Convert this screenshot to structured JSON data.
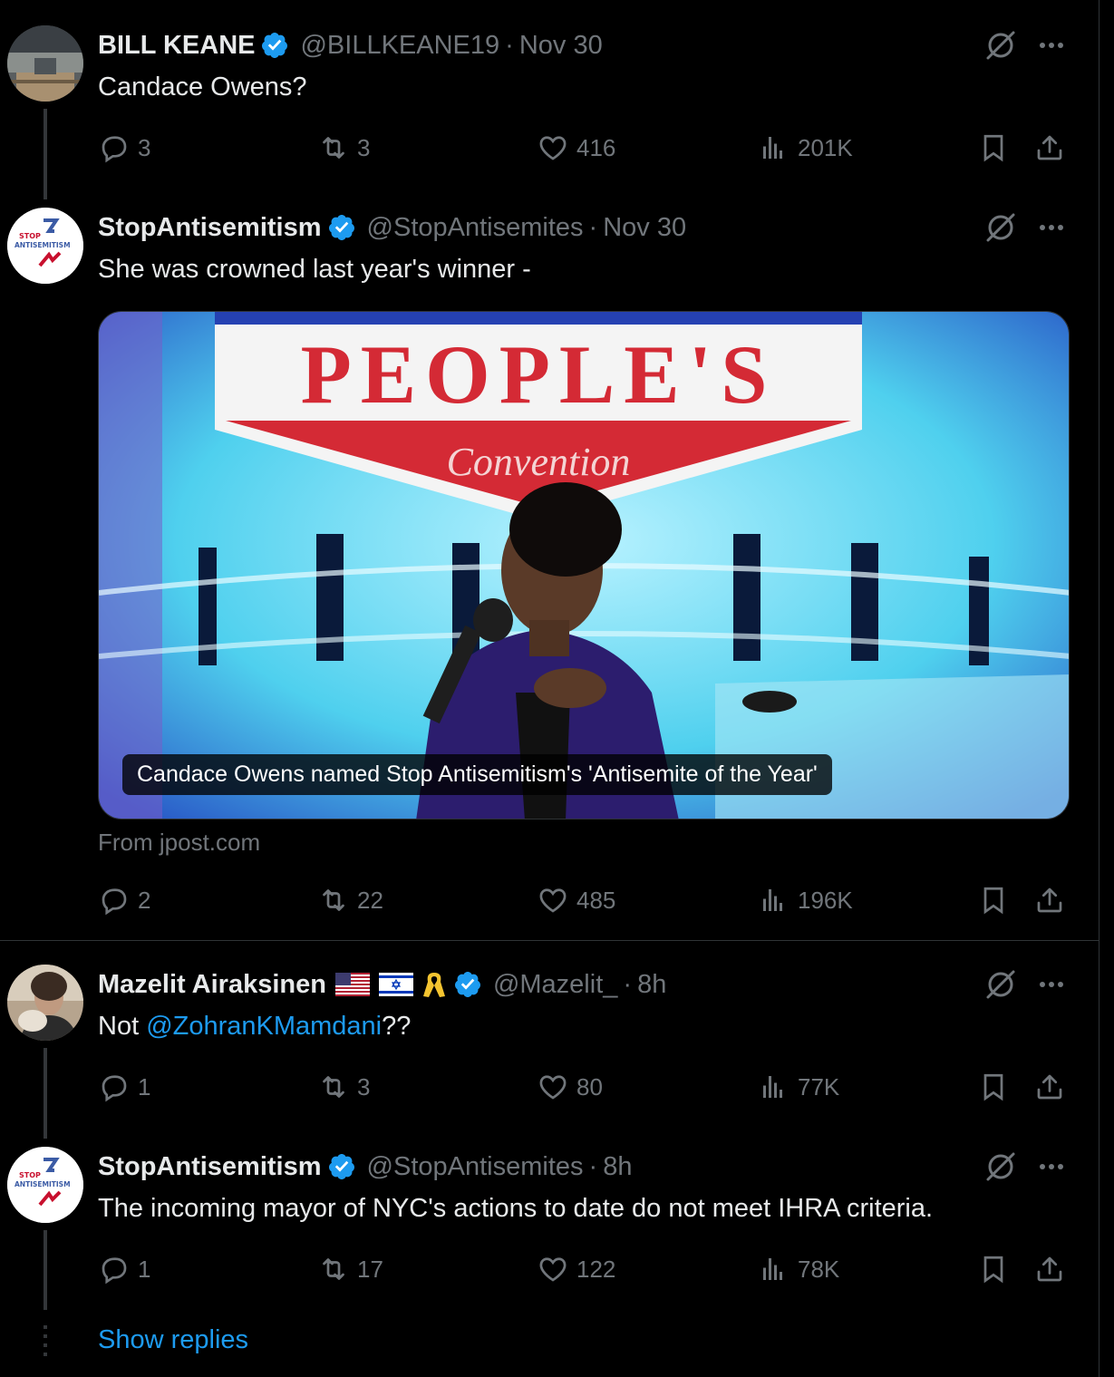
{
  "colors": {
    "background": "#000000",
    "text": "#e7e9ea",
    "muted": "#71767b",
    "accent": "#1d9bf0",
    "verified": "#1d9bf0"
  },
  "tweets": [
    {
      "name": "BILL KEANE",
      "handle": "@BILLKEANE19",
      "separator": "·",
      "time": "Nov 30",
      "text": "Candace Owens?",
      "replies": "3",
      "reposts": "3",
      "likes": "416",
      "views": "201K"
    },
    {
      "name": "StopAntisemitism",
      "handle": "@StopAntisemites",
      "separator": "·",
      "time": "Nov 30",
      "text": "She was crowned last year's winner -",
      "media": {
        "caption": "Candace Owens named Stop Antisemitism's 'Antisemite of the Year'",
        "banner_text": "PEOPLE'S",
        "banner_subtext": "Convention",
        "source": "From jpost.com"
      },
      "replies": "2",
      "reposts": "22",
      "likes": "485",
      "views": "196K"
    },
    {
      "name": "Mazelit Airaksinen",
      "handle": "@Mazelit_",
      "separator": "·",
      "time": "8h",
      "text_prefix": "Not ",
      "mention": "@ZohranKMamdani",
      "text_suffix": "??",
      "badges": [
        "us-flag-icon",
        "israel-flag-icon",
        "yellow-ribbon-icon"
      ],
      "replies": "1",
      "reposts": "3",
      "likes": "80",
      "views": "77K"
    },
    {
      "name": "StopAntisemitism",
      "handle": "@StopAntisemites",
      "separator": "·",
      "time": "8h",
      "text": "The incoming mayor of NYC's actions to date do not meet IHRA criteria.",
      "replies": "1",
      "reposts": "17",
      "likes": "122",
      "views": "78K"
    }
  ],
  "avatar_logo": {
    "line1": "STOP",
    "line2": "ANTISEMITISM"
  },
  "show_replies": "Show replies"
}
